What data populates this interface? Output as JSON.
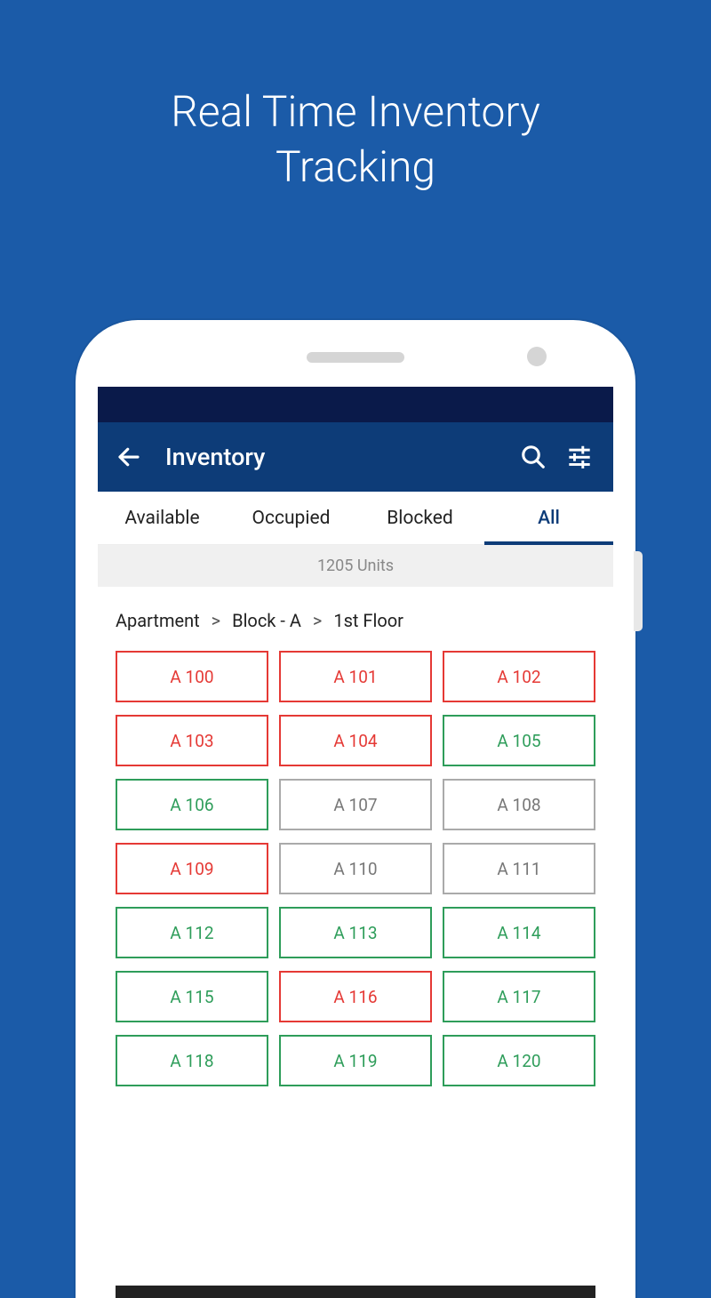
{
  "hero": {
    "line1": "Real Time Inventory",
    "line2": "Tracking"
  },
  "header": {
    "title": "Inventory"
  },
  "tabs": [
    {
      "label": "Available",
      "active": false
    },
    {
      "label": "Occupied",
      "active": false
    },
    {
      "label": "Blocked",
      "active": false
    },
    {
      "label": "All",
      "active": true
    }
  ],
  "unit_count": "1205 Units",
  "breadcrumb": {
    "level1": "Apartment",
    "level2": "Block - A",
    "level3": "1st Floor"
  },
  "units": [
    {
      "label": "A 100",
      "status": "red"
    },
    {
      "label": "A 101",
      "status": "red"
    },
    {
      "label": "A 102",
      "status": "red"
    },
    {
      "label": "A 103",
      "status": "red"
    },
    {
      "label": "A 104",
      "status": "red"
    },
    {
      "label": "A 105",
      "status": "green"
    },
    {
      "label": "A 106",
      "status": "green"
    },
    {
      "label": "A 107",
      "status": "grey"
    },
    {
      "label": "A 108",
      "status": "grey"
    },
    {
      "label": "A 109",
      "status": "red"
    },
    {
      "label": "A 110",
      "status": "grey"
    },
    {
      "label": "A 111",
      "status": "grey"
    },
    {
      "label": "A 112",
      "status": "green"
    },
    {
      "label": "A 113",
      "status": "green"
    },
    {
      "label": "A 114",
      "status": "green"
    },
    {
      "label": "A 115",
      "status": "green"
    },
    {
      "label": "A 116",
      "status": "red"
    },
    {
      "label": "A 117",
      "status": "green"
    },
    {
      "label": "A 118",
      "status": "green"
    },
    {
      "label": "A 119",
      "status": "green"
    },
    {
      "label": "A 120",
      "status": "green"
    }
  ]
}
